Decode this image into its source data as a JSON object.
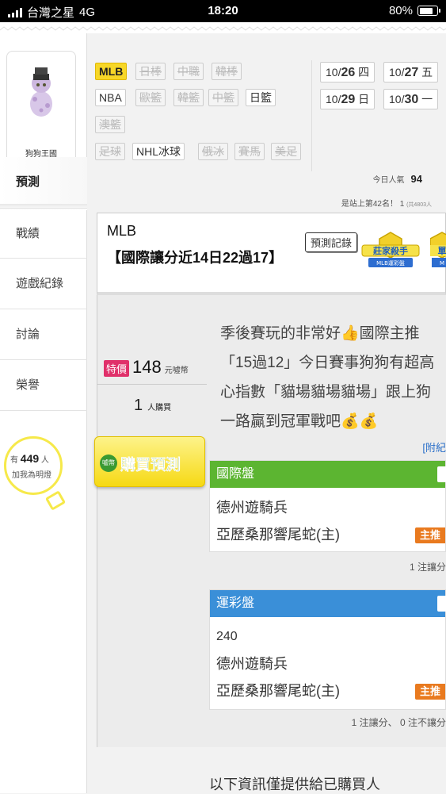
{
  "status_bar": {
    "carrier": "台灣之星",
    "network": "4G",
    "time": "18:20",
    "battery": "80%"
  },
  "sidebar": {
    "profile_name": "狗狗王國",
    "items": [
      {
        "label": "預測",
        "active": true
      },
      {
        "label": "戰績"
      },
      {
        "label": "遊戲紀錄"
      },
      {
        "label": "討論"
      },
      {
        "label": "榮譽"
      }
    ],
    "fans": {
      "prefix": "有",
      "count": "449",
      "unit": "人",
      "cta": "加我為明燈"
    }
  },
  "leagues": [
    {
      "label": "MLB",
      "state": "active"
    },
    {
      "label": "日棒",
      "state": "off"
    },
    {
      "label": "中職",
      "state": "off"
    },
    {
      "label": "韓棒",
      "state": "off"
    },
    {
      "label": "NBA",
      "state": "on"
    },
    {
      "label": "歐籃",
      "state": "off"
    },
    {
      "label": "韓籃",
      "state": "off"
    },
    {
      "label": "中籃",
      "state": "off"
    },
    {
      "label": "日籃",
      "state": "on"
    },
    {
      "label": "澳籃",
      "state": "off"
    },
    {
      "label": "足球",
      "state": "off"
    },
    {
      "label": "NHL冰球",
      "state": "on"
    },
    {
      "label": "俄冰",
      "state": "off"
    },
    {
      "label": "賽馬",
      "state": "off"
    },
    {
      "label": "美足",
      "state": "off"
    }
  ],
  "dates": [
    {
      "md": "10/",
      "d": "26",
      "wd": "四"
    },
    {
      "md": "10/",
      "d": "27",
      "wd": "五"
    },
    {
      "md": "10/",
      "d": "29",
      "wd": "日"
    },
    {
      "md": "10/",
      "d": "30",
      "wd": "一"
    }
  ],
  "stats": {
    "popularity_label": "今日人氣",
    "popularity_value": "94",
    "rank_text": "是站上第42名！",
    "rank_extra": "1",
    "rank_small": "(共4803人"
  },
  "prediction": {
    "league": "MLB",
    "title": "【國際讓分近14日22過17】",
    "record_button": "預測記錄",
    "badge_text": "莊家殺手",
    "badge_sub": "MLB運彩盤",
    "badge2_text": "單",
    "badge2_sub": "M"
  },
  "purchase": {
    "tag": "特價",
    "price": "148",
    "currency": "元噓幣",
    "buyers": "1",
    "buyers_unit": "人購買",
    "button_icon": "噓幣",
    "button_label": "購買預測"
  },
  "description": [
    "季後賽玩的非常好👍國際主推",
    "「15過12」今日賽事狗狗有超高",
    "心指數「貓場貓場貓場」跟上狗",
    "一路贏到冠軍戰吧💰💰"
  ],
  "attachment_link": "[附紀",
  "panels": [
    {
      "header": "國際盤",
      "color": "#5cb531",
      "line": "",
      "team_away": "德州遊騎兵",
      "team_home": "亞歷桑那響尾蛇(主)",
      "home_tag": "主推",
      "footer": "1 注讓分"
    },
    {
      "header": "運彩盤",
      "color": "#3a8fd8",
      "line": "240",
      "team_away": "德州遊騎兵",
      "team_home": "亞歷桑那響尾蛇(主)",
      "home_tag": "主推",
      "footer": "1 注讓分、 0 注不讓分"
    }
  ],
  "bottom_note": "以下資訊僅提供給已購買人"
}
